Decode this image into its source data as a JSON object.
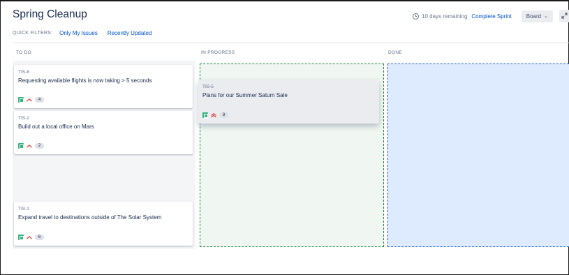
{
  "board": {
    "title": "Spring Cleanup",
    "remaining": "10 days remaining",
    "complete_sprint": "Complete Sprint",
    "board_button": "Board",
    "board_button_chevron": "⌄"
  },
  "filters": {
    "label": "QUICK FILTERS:",
    "items": [
      "Only My Issues",
      "Recently Updated"
    ]
  },
  "columns": [
    {
      "name": "TO DO"
    },
    {
      "name": "IN PROGRESS"
    },
    {
      "name": "DONE"
    }
  ],
  "cards": [
    {
      "key": "TIS-8",
      "summary": "Requesting available flights is now taking > 5 seconds",
      "priority": "high",
      "points": "4"
    },
    {
      "key": "TIS-2",
      "summary": "Build out a local office on Mars",
      "priority": "high",
      "points": "2"
    },
    {
      "key": "TIS-1",
      "summary": "Expand travel to destinations outside of The Solar System",
      "priority": "high",
      "points": "6"
    },
    {
      "key": "TIS-5",
      "summary": "Plans for our Summer Saturn Sale",
      "priority": "highest",
      "points": "8"
    }
  ],
  "colors": {
    "link": "#0052cc",
    "story": "#36b37e",
    "priority": "#e5493a",
    "in_progress_drop": "#1f8a3a",
    "done_drop": "#1f5fc8"
  },
  "icons": {
    "clock": "clock-icon",
    "story": "story-icon",
    "priority_high": "priority-high-icon",
    "priority_highest": "priority-highest-icon",
    "expand": "expand-icon"
  }
}
